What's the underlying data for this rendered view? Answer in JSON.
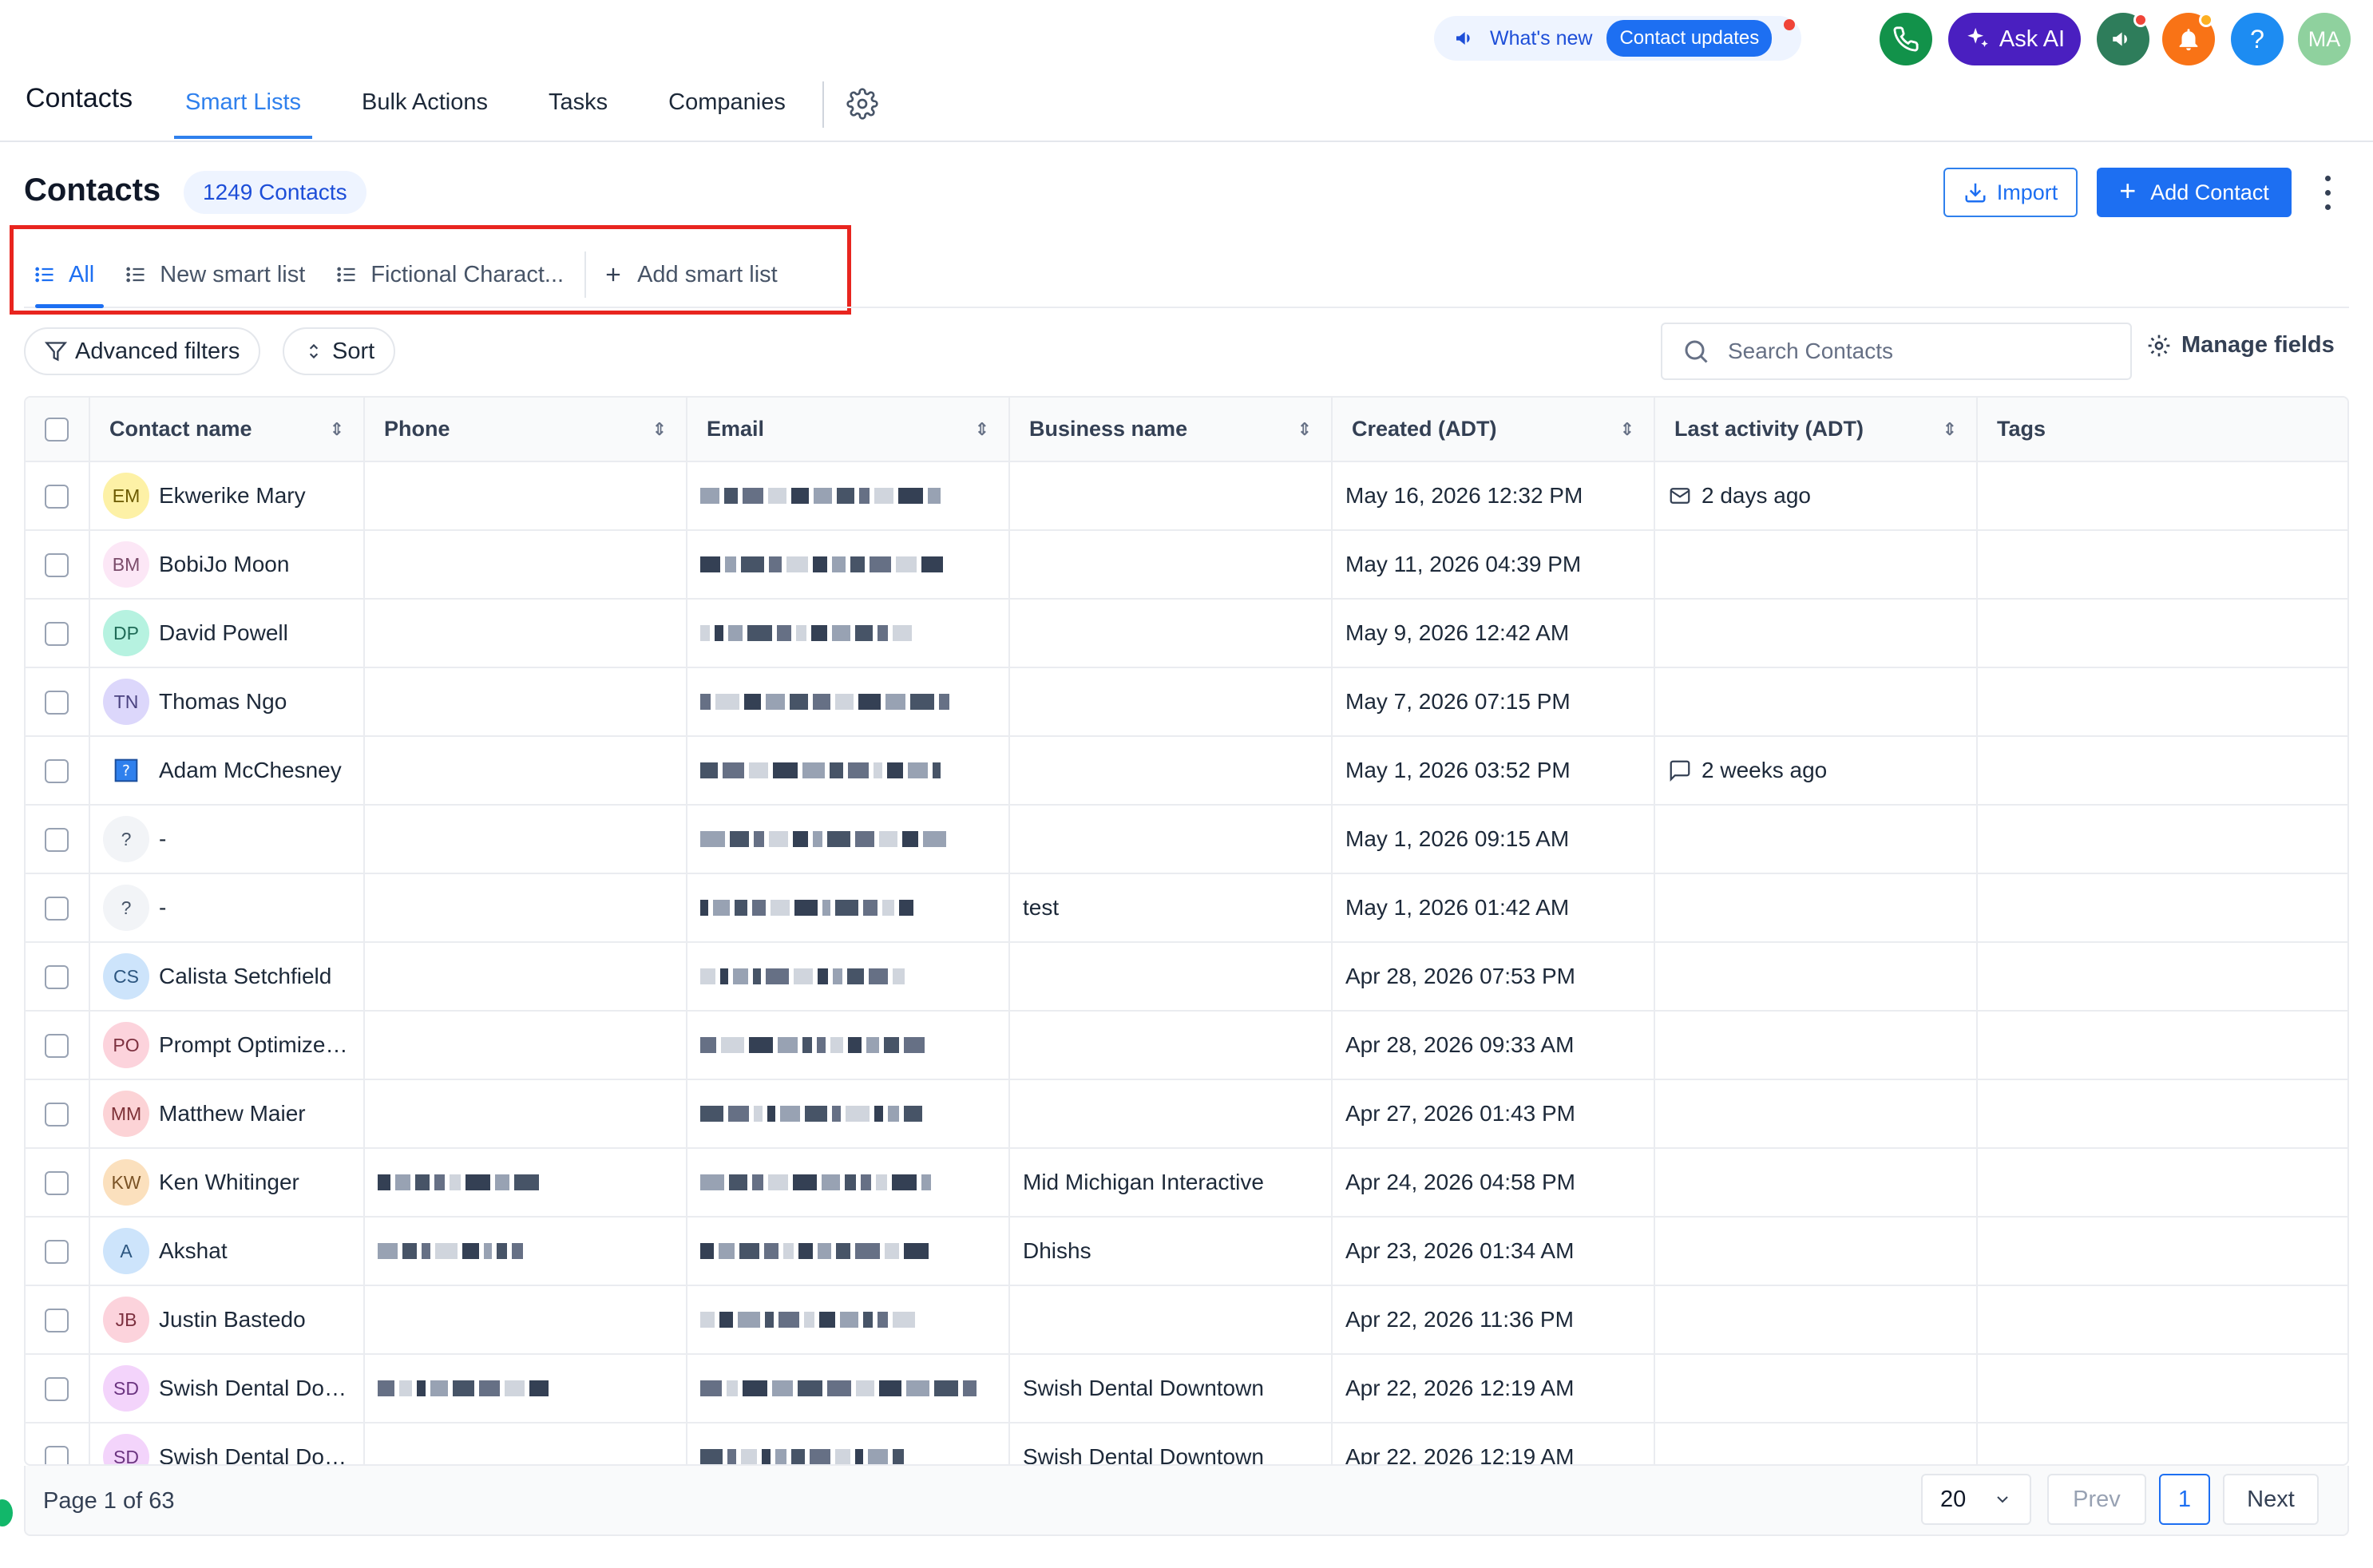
{
  "topbar": {
    "title": "Contacts",
    "tabs": [
      {
        "label": "Smart Lists",
        "active": true
      },
      {
        "label": "Bulk Actions",
        "active": false
      },
      {
        "label": "Tasks",
        "active": false
      },
      {
        "label": "Companies",
        "active": false
      }
    ],
    "whats_new": "What's new",
    "contact_updates": "Contact updates",
    "ask_ai": "Ask AI",
    "help": "?",
    "user_initials": "MA",
    "icons": [
      "phone-icon",
      "sparkle-icon",
      "megaphone-icon",
      "bell-icon",
      "help-icon",
      "gear-icon"
    ]
  },
  "header": {
    "title": "Contacts",
    "count_badge": "1249 Contacts",
    "import_label": "Import",
    "add_contact_label": "Add Contact"
  },
  "smart_lists": {
    "tabs": [
      {
        "label": "All",
        "active": true
      },
      {
        "label": "New smart list",
        "active": false
      },
      {
        "label": "Fictional Charact...",
        "active": false
      }
    ],
    "add_label": "Add smart list"
  },
  "filters": {
    "advanced_filters": "Advanced filters",
    "sort": "Sort",
    "search_placeholder": "Search Contacts",
    "manage_fields": "Manage fields"
  },
  "table": {
    "columns": [
      "Contact name",
      "Phone",
      "Email",
      "Business name",
      "Created (ADT)",
      "Last activity (ADT)",
      "Tags"
    ],
    "rows": [
      {
        "initials": "EM",
        "avatar_bg": "#fdf1a6",
        "avatar_fg": "#6b5a00",
        "name": "Ekwerike Mary",
        "business": "",
        "created": "May 16, 2026 12:32 PM",
        "activity": "2 days ago",
        "activity_icon": "mail-icon"
      },
      {
        "initials": "BM",
        "avatar_bg": "#fce7f6",
        "avatar_fg": "#7a4b6a",
        "name": "BobiJo Moon",
        "business": "",
        "created": "May 11, 2026 04:39 PM",
        "activity": "",
        "activity_icon": ""
      },
      {
        "initials": "DP",
        "avatar_bg": "#b6f2e0",
        "avatar_fg": "#1f6b57",
        "name": "David Powell",
        "business": "",
        "created": "May 9, 2026 12:42 AM",
        "activity": "",
        "activity_icon": ""
      },
      {
        "initials": "TN",
        "avatar_bg": "#dcd7fb",
        "avatar_fg": "#4a4280",
        "name": "Thomas Ngo",
        "business": "",
        "created": "May 7, 2026 07:15 PM",
        "activity": "",
        "activity_icon": ""
      },
      {
        "initials": "",
        "avatar_bg": "",
        "avatar_fg": "",
        "name": "Adam McChesney",
        "business": "",
        "created": "May 1, 2026 03:52 PM",
        "activity": "2 weeks ago",
        "activity_icon": "chat-icon",
        "image_avatar": true
      },
      {
        "initials": "?",
        "avatar_bg": "#f2f4f7",
        "avatar_fg": "#475467",
        "name": "-",
        "business": "",
        "created": "May 1, 2026 09:15 AM",
        "activity": "",
        "activity_icon": ""
      },
      {
        "initials": "?",
        "avatar_bg": "#f2f4f7",
        "avatar_fg": "#475467",
        "name": "-",
        "business": "test",
        "created": "May 1, 2026 01:42 AM",
        "activity": "",
        "activity_icon": ""
      },
      {
        "initials": "CS",
        "avatar_bg": "#cde4fb",
        "avatar_fg": "#2c5680",
        "name": "Calista Setchfield",
        "business": "",
        "created": "Apr 28, 2026 07:53 PM",
        "activity": "",
        "activity_icon": ""
      },
      {
        "initials": "PO",
        "avatar_bg": "#fcd3dc",
        "avatar_fg": "#7d3140",
        "name": "Prompt Optimizer Test ...",
        "business": "",
        "created": "Apr 28, 2026 09:33 AM",
        "activity": "",
        "activity_icon": ""
      },
      {
        "initials": "MM",
        "avatar_bg": "#fcd3d6",
        "avatar_fg": "#7d3137",
        "name": "Matthew Maier",
        "business": "",
        "created": "Apr 27, 2026 01:43 PM",
        "activity": "",
        "activity_icon": ""
      },
      {
        "initials": "KW",
        "avatar_bg": "#fbe0bd",
        "avatar_fg": "#7a5326",
        "name": "Ken Whitinger",
        "business": "Mid Michigan Interactive",
        "created": "Apr 24, 2026 04:58 PM",
        "activity": "",
        "activity_icon": ""
      },
      {
        "initials": "A",
        "avatar_bg": "#cde4fb",
        "avatar_fg": "#2c5680",
        "name": "Akshat",
        "business": "Dhishs",
        "created": "Apr 23, 2026 01:34 AM",
        "activity": "",
        "activity_icon": ""
      },
      {
        "initials": "JB",
        "avatar_bg": "#fcd3dc",
        "avatar_fg": "#7d3140",
        "name": "Justin Bastedo",
        "business": "",
        "created": "Apr 22, 2026 11:36 PM",
        "activity": "",
        "activity_icon": ""
      },
      {
        "initials": "SD",
        "avatar_bg": "#f3d4fb",
        "avatar_fg": "#6b3480",
        "name": "Swish Dental Downtown",
        "business": "Swish Dental Downtown",
        "created": "Apr 22, 2026 12:19 AM",
        "activity": "",
        "activity_icon": ""
      },
      {
        "initials": "SD",
        "avatar_bg": "#f3d4fb",
        "avatar_fg": "#6b3480",
        "name": "Swish Dental Downtown",
        "business": "Swish Dental Downtown",
        "created": "Apr 22, 2026 12:19 AM",
        "activity": "",
        "activity_icon": ""
      }
    ]
  },
  "pagination": {
    "page_info": "Page 1 of 63",
    "per_page": "20",
    "prev": "Prev",
    "current": "1",
    "next": "Next"
  },
  "colors": {
    "accent": "#1d6ff2",
    "highlight_box": "#e8251f",
    "ask_ai": "#4a1fc0",
    "phone": "#12924a"
  }
}
